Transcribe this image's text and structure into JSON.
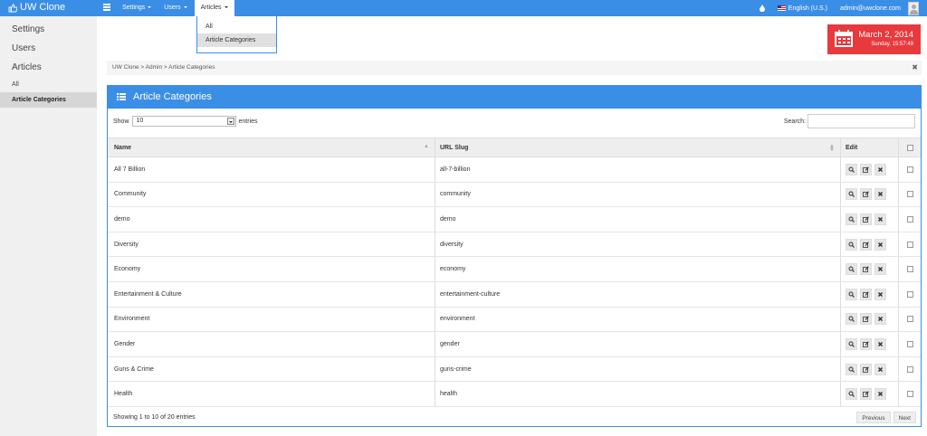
{
  "app": {
    "title": "UW Clone"
  },
  "topnav": [
    {
      "label": "Settings",
      "active": false
    },
    {
      "label": "Users",
      "active": false
    },
    {
      "label": "Articles",
      "active": true
    }
  ],
  "topright": {
    "language": "English (U.S.)",
    "user_email": "admin@uwclone.com"
  },
  "articles_menu": [
    {
      "label": "All",
      "active": false
    },
    {
      "label": "Article Categories",
      "active": true
    }
  ],
  "sidebar": {
    "items": [
      {
        "label": "Settings"
      },
      {
        "label": "Users"
      },
      {
        "label": "Articles"
      }
    ],
    "subitems": [
      {
        "label": "All",
        "active": false
      },
      {
        "label": "Article Categories",
        "active": true
      }
    ]
  },
  "datebox": {
    "date": "March 2, 2014",
    "time": "Sunday, 15:57:49"
  },
  "breadcrumb": {
    "path": "UW Clone > Admin > Article Categories",
    "close_icon": "close-icon"
  },
  "panel": {
    "title": "Article Categories",
    "show_label": "Show",
    "entries_value": "10",
    "entries_label": "entries",
    "search_label": "Search:",
    "search_value": ""
  },
  "table": {
    "columns": {
      "name": "Name",
      "slug": "URL Slug",
      "edit": "Edit"
    },
    "rows": [
      {
        "name": "All 7 Billion",
        "slug": "all-7-billion"
      },
      {
        "name": "Community",
        "slug": "community"
      },
      {
        "name": "demo",
        "slug": "demo"
      },
      {
        "name": "Diversity",
        "slug": "diversity"
      },
      {
        "name": "Economy",
        "slug": "economy"
      },
      {
        "name": "Entertainment & Culture",
        "slug": "entertainment-culture"
      },
      {
        "name": "Environment",
        "slug": "environment"
      },
      {
        "name": "Gender",
        "slug": "gender"
      },
      {
        "name": "Guns & Crime",
        "slug": "guns-crime"
      },
      {
        "name": "Health",
        "slug": "health"
      }
    ]
  },
  "footer": {
    "info": "Showing 1 to 10 of 20 entries",
    "prev": "Previous",
    "next": "Next"
  },
  "colors": {
    "accent": "#3a8ee6",
    "date_red": "#e8393d",
    "sidebar_bg": "#f0f0f0"
  }
}
